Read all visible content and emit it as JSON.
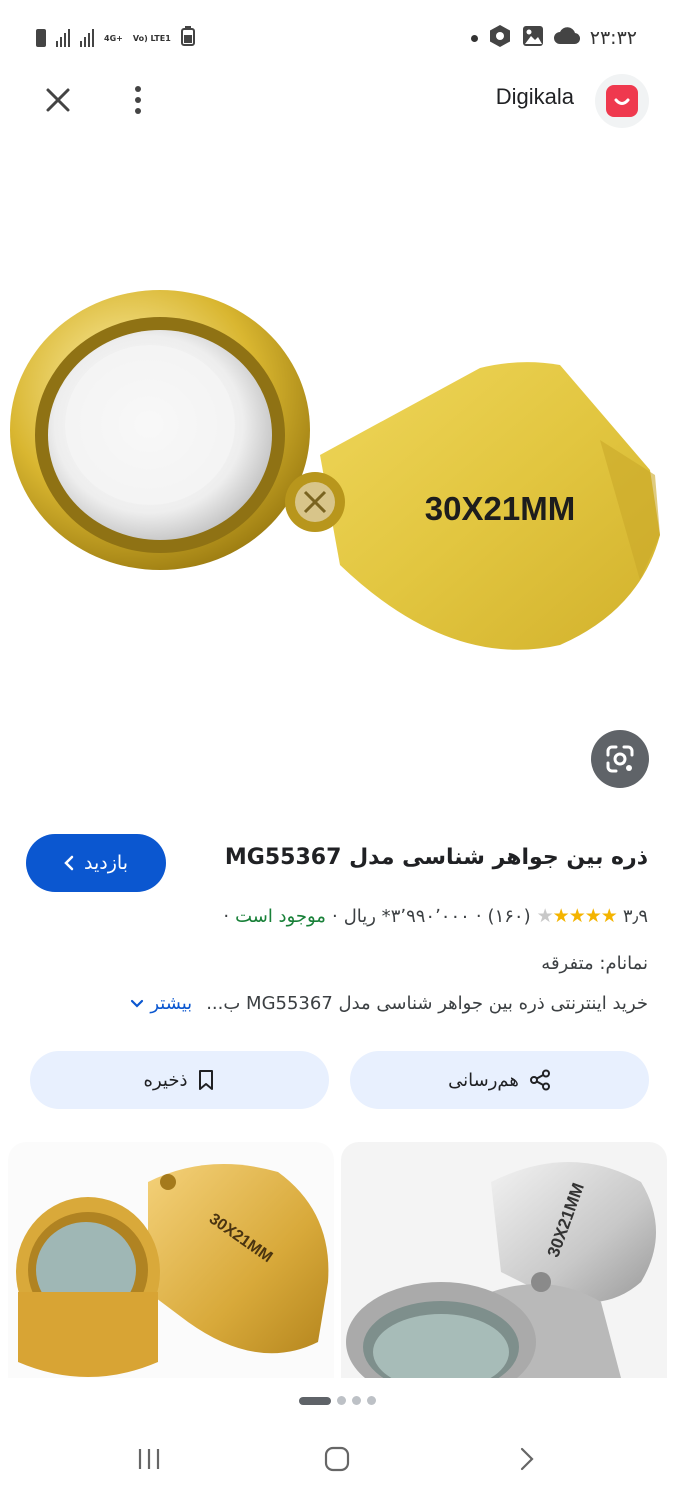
{
  "status_bar": {
    "time": "۲۳:۳۲",
    "network_primary": "4G+",
    "network_secondary": "Vo) LTE1"
  },
  "header": {
    "site_name": "Digikala",
    "brand_color": "#ef394e"
  },
  "hero_image": {
    "engraving": "30X21MM"
  },
  "product": {
    "title": "ذره بین جواهر شناسی مدل MG55367",
    "visit_label": "بازدید",
    "rating_value": "۳٫۹",
    "rating_stars": 3.9,
    "review_count": "(۱۶۰)",
    "price": "۳٬۹۹۰٬۰۰۰* ریال",
    "availability": "موجود است",
    "brand_line": "نمانام: متفرقه",
    "description": "خرید اینترنتی ذره بین جواهر شناسی مدل MG55367 ب...",
    "more_label": "بیشتر"
  },
  "actions": {
    "share_label": "هم‌رسانی",
    "save_label": "ذخیره"
  },
  "related": {
    "item1_engraving": "30X21MM",
    "item2_engraving": "30X21MM"
  },
  "pager": {
    "current": 1,
    "total": 4
  },
  "colors": {
    "accent": "#0b57d0",
    "action_bg": "#e8f0fe",
    "star": "#f4b400",
    "available": "#188038"
  }
}
